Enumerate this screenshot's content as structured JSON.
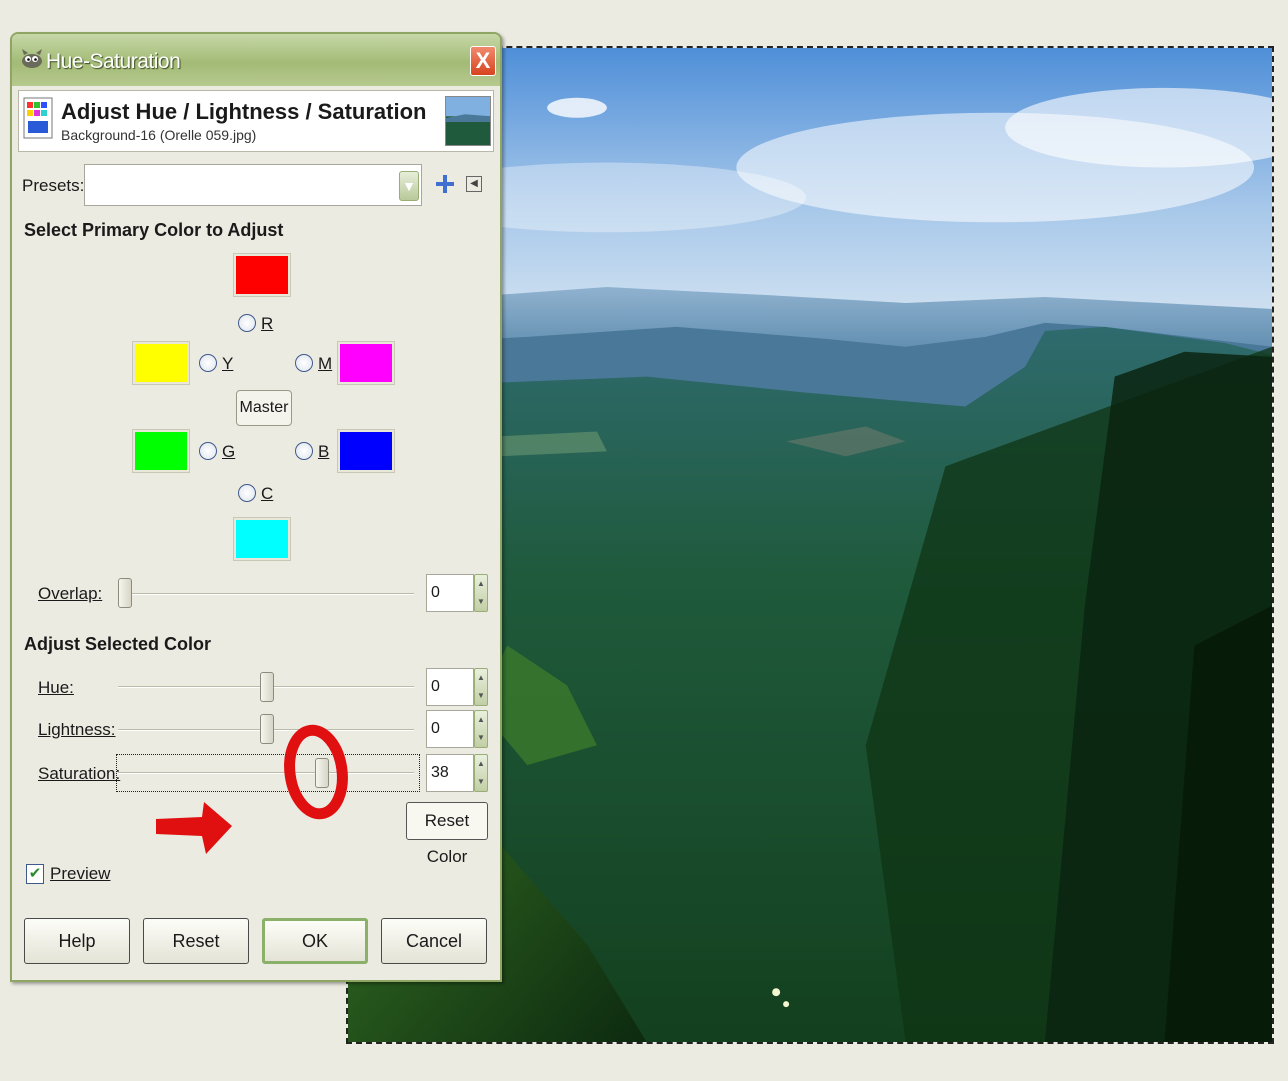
{
  "dialog": {
    "title": "Hue-Saturation",
    "close_label": "X",
    "header_title": "Adjust Hue / Lightness / Saturation",
    "header_subtitle": "Background-16 (Orelle 059.jpg)",
    "presets_label": "Presets:",
    "presets_value": "",
    "primary_section": "Select Primary Color to Adjust",
    "colors": [
      {
        "key": "R",
        "hex": "#ff0000"
      },
      {
        "key": "Y",
        "hex": "#ffff00"
      },
      {
        "key": "M",
        "hex": "#ff00ff"
      },
      {
        "key": "G",
        "hex": "#00ff00"
      },
      {
        "key": "B",
        "hex": "#0000ff"
      },
      {
        "key": "C",
        "hex": "#00ffff"
      }
    ],
    "master_label": "Master",
    "overlap_label": "Overlap:",
    "overlap_value": "0",
    "adjust_section": "Adjust Selected Color",
    "hue_label": "Hue:",
    "hue_value": "0",
    "lightness_label": "Lightness:",
    "lightness_value": "0",
    "saturation_label": "Saturation:",
    "saturation_value": "38",
    "reset_color_label": "Reset Color",
    "preview_label": "Preview",
    "preview_checked": true,
    "buttons": {
      "help": "Help",
      "reset": "Reset",
      "ok": "OK",
      "cancel": "Cancel"
    }
  },
  "annotation_color": "#e01010",
  "icons": [
    "gimp-wilber-icon",
    "hue-saturation-icon",
    "add-icon",
    "menu-arrow-icon",
    "chevron-down-icon",
    "checkmark-icon"
  ]
}
